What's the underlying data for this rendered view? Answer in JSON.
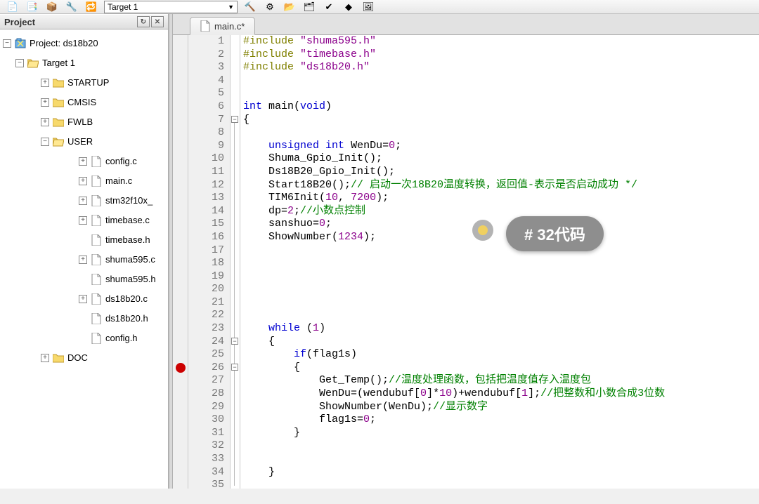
{
  "toolbar": {
    "target_combo": "Target 1"
  },
  "project_panel": {
    "title": "Project",
    "root": "Project: ds18b20",
    "target": "Target 1",
    "folders": {
      "startup": "STARTUP",
      "cmsis": "CMSIS",
      "fwlb": "FWLB",
      "user": "USER",
      "doc": "DOC"
    },
    "user_files": [
      "config.c",
      "main.c",
      "stm32f10x_",
      "timebase.c",
      "timebase.h",
      "shuma595.c",
      "shuma595.h",
      "ds18b20.c",
      "ds18b20.h",
      "config.h"
    ]
  },
  "editor": {
    "tab_label": "main.c*",
    "breakpoint_line": 26,
    "lines": [
      {
        "n": 1,
        "html": "<span class='pp'>#include</span> <span class='str'>\"shuma595.h\"</span>"
      },
      {
        "n": 2,
        "html": "<span class='pp'>#include</span> <span class='str'>\"timebase.h\"</span>"
      },
      {
        "n": 3,
        "html": "<span class='pp'>#include</span> <span class='str'>\"ds18b20.h\"</span>"
      },
      {
        "n": 4,
        "html": ""
      },
      {
        "n": 5,
        "html": ""
      },
      {
        "n": 6,
        "html": "<span class='kw'>int</span> main(<span class='kw'>void</span>)"
      },
      {
        "n": 7,
        "html": "{"
      },
      {
        "n": 8,
        "html": ""
      },
      {
        "n": 9,
        "html": "    <span class='kw'>unsigned</span> <span class='kw'>int</span> WenDu=<span class='num'>0</span>;"
      },
      {
        "n": 10,
        "html": "    Shuma_Gpio_Init();"
      },
      {
        "n": 11,
        "html": "    Ds18B20_Gpio_Init();"
      },
      {
        "n": 12,
        "html": "    Start18B20();<span class='cm'>// 启动一次18B20温度转换，返回值-表示是否启动成功 */</span>"
      },
      {
        "n": 13,
        "html": "    TIM6Init(<span class='num'>10</span>, <span class='num'>7200</span>);"
      },
      {
        "n": 14,
        "html": "    dp=<span class='num'>2</span>;<span class='cm'>//小数点控制</span>"
      },
      {
        "n": 15,
        "html": "    sanshuo=<span class='num'>0</span>;"
      },
      {
        "n": 16,
        "html": "    ShowNumber(<span class='num'>1234</span>);"
      },
      {
        "n": 17,
        "html": ""
      },
      {
        "n": 18,
        "html": ""
      },
      {
        "n": 19,
        "html": ""
      },
      {
        "n": 20,
        "html": ""
      },
      {
        "n": 21,
        "html": ""
      },
      {
        "n": 22,
        "html": ""
      },
      {
        "n": 23,
        "html": "    <span class='kw'>while</span> (<span class='num'>1</span>)"
      },
      {
        "n": 24,
        "html": "    {"
      },
      {
        "n": 25,
        "html": "        <span class='kw'>if</span>(flag1s)"
      },
      {
        "n": 26,
        "html": "        {"
      },
      {
        "n": 27,
        "html": "            Get_Temp();<span class='cm'>//温度处理函数，包括把温度值存入温度包</span>"
      },
      {
        "n": 28,
        "html": "            WenDu=(wendubuf[<span class='num'>0</span>]*<span class='num'>10</span>)+wendubuf[<span class='num'>1</span>];<span class='cm'>//把整数和小数合成3位数</span>"
      },
      {
        "n": 29,
        "html": "            ShowNumber(WenDu);<span class='cm'>//显示数字</span>"
      },
      {
        "n": 30,
        "html": "            flag1s=<span class='num'>0</span>;"
      },
      {
        "n": 31,
        "html": "        }"
      },
      {
        "n": 32,
        "html": ""
      },
      {
        "n": 33,
        "html": ""
      },
      {
        "n": 34,
        "html": "    }"
      },
      {
        "n": 35,
        "html": ""
      }
    ],
    "fold_markers": [
      {
        "line": 7,
        "sym": "−"
      },
      {
        "line": 24,
        "sym": "−"
      },
      {
        "line": 26,
        "sym": "−"
      }
    ]
  },
  "overlay": {
    "badge": "# 32代码"
  }
}
